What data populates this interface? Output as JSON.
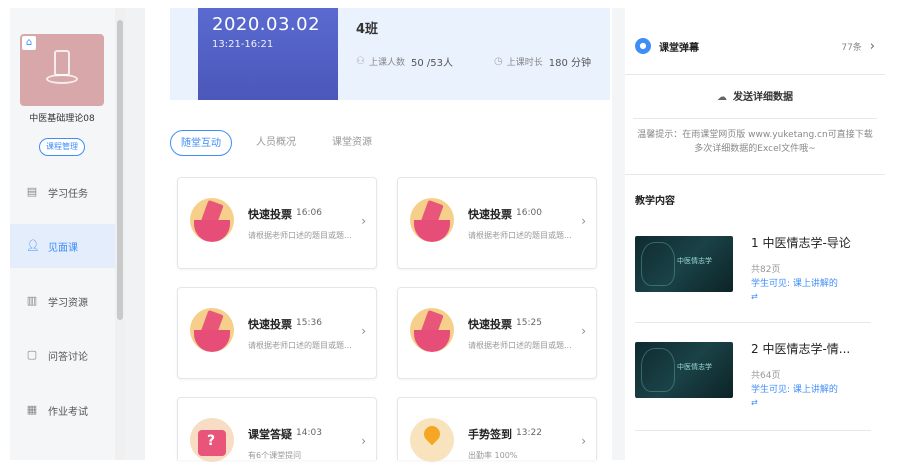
{
  "sidebar": {
    "course_name": "中医基础理论08",
    "manage_label": "课程管理",
    "items": [
      {
        "label": "学习任务",
        "icon": "document-icon",
        "active": false
      },
      {
        "label": "见面课",
        "icon": "person-icon",
        "active": true
      },
      {
        "label": "学习资源",
        "icon": "book-icon",
        "active": false
      },
      {
        "label": "问答讨论",
        "icon": "chat-icon",
        "active": false
      },
      {
        "label": "作业考试",
        "icon": "exam-icon",
        "active": false
      }
    ]
  },
  "session": {
    "date": "2020.03.02",
    "time": "13:21-16:21",
    "class_name": "4班",
    "attendance_label": "上课人数",
    "attendance_value": "50 /53人",
    "duration_label": "上课时长",
    "duration_value": "180 分钟"
  },
  "tabs": [
    {
      "label": "随堂互动",
      "active": true
    },
    {
      "label": "人员概况",
      "active": false
    },
    {
      "label": "课堂资源",
      "active": false
    }
  ],
  "activities": [
    {
      "title": "快速投票",
      "time": "16:06",
      "desc": "请根据老师口述的题目或题...",
      "icon": "vote-icon"
    },
    {
      "title": "快速投票",
      "time": "16:00",
      "desc": "请根据老师口述的题目或题...",
      "icon": "vote-icon"
    },
    {
      "title": "快速投票",
      "time": "15:36",
      "desc": "请根据老师口述的题目或题...",
      "icon": "vote-icon"
    },
    {
      "title": "快速投票",
      "time": "15:25",
      "desc": "请根据老师口述的题目或题...",
      "icon": "vote-icon"
    },
    {
      "title": "课堂答疑",
      "time": "14:03",
      "desc": "有6个课堂提问",
      "icon": "question-icon"
    },
    {
      "title": "手势签到",
      "time": "13:22",
      "desc": "出勤率 100%",
      "icon": "sign-in-icon"
    }
  ],
  "right": {
    "bullet_label": "课堂弹幕",
    "bullet_count": "77条",
    "send_label": "发送详细数据",
    "tip": "温馨提示：在雨课堂网页版 www.yuketang.cn可直接下载多次详细数据的Excel文件哦~",
    "section_title": "教学内容",
    "lessons": [
      {
        "title": "1 中医情志学-导论",
        "pages": "共82页",
        "visibility": "学生可见: 课上讲解的",
        "thumb_text": "中医情志学"
      },
      {
        "title": "2 中医情志学-情...",
        "pages": "共64页",
        "visibility": "学生可见: 课上讲解的",
        "thumb_text": "中医情志学"
      }
    ]
  },
  "colors": {
    "accent": "#3f8ef8",
    "date_card": "#4b57b9",
    "vote_pink": "#e64d78"
  }
}
